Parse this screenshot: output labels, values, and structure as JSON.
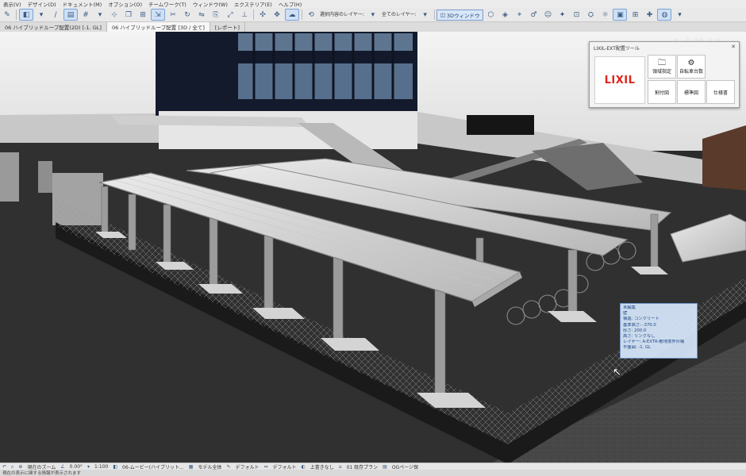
{
  "menu": [
    "表示(V)",
    "デザイン(D)",
    "ドキュメント(M)",
    "オプション(O)",
    "チームワーク(T)",
    "ウィンドウ(W)",
    "エクステリア(E)",
    "ヘルプ(H)"
  ],
  "toolbar": {
    "layer_label_1": "選択内容のレイヤー:",
    "layer_label_2": "全てのレイヤー:",
    "btn_3d_window": "3Dウィンドウ"
  },
  "tabs": [
    "06 ハイブリッドループ配置(2D) [-1. GL]",
    "06 ハイブリッドループ配置 [3D / 全て]",
    "[レポート]"
  ],
  "active_tab_index": 1,
  "palette": {
    "title": "LIXIL-EXT配置ツール",
    "logo_text": "LIXIL",
    "buttons": [
      {
        "label": "領域指定",
        "icon": "folder-icon"
      },
      {
        "label": "自転車台数",
        "icon": "bicycle-icon"
      },
      {
        "label": "割付図",
        "icon": ""
      },
      {
        "label": "標準図",
        "icon": ""
      },
      {
        "label": "仕様書",
        "icon": ""
      }
    ]
  },
  "brand_watermark": "LIXIL",
  "tooltip": {
    "lines": [
      "未編集",
      "壁",
      "構造: コンクリート",
      "基準高さ: -370.0",
      "厚さ: 200.0",
      "高さ: リンクなし",
      "レイヤー: A-EXTR-敷地境界外構",
      "平面図: -1. GL"
    ]
  },
  "status": {
    "zoom_label": "現在のズーム",
    "angle": "0.00°",
    "scale": "1:100",
    "view": "06-ムービー(ハイブリット...",
    "model": "モデル全体",
    "default1": "デフォルト",
    "default2": "デフォルト",
    "override": "上書きなし",
    "plan": "01 既存プラン",
    "pages": "OGページ保"
  },
  "hint": "現在の表示に関する情報が表示されます",
  "colors": {
    "accent": "#3a5c86",
    "tooltip_bg": "#d7e8fc",
    "lixil_red": "#e2231a"
  }
}
